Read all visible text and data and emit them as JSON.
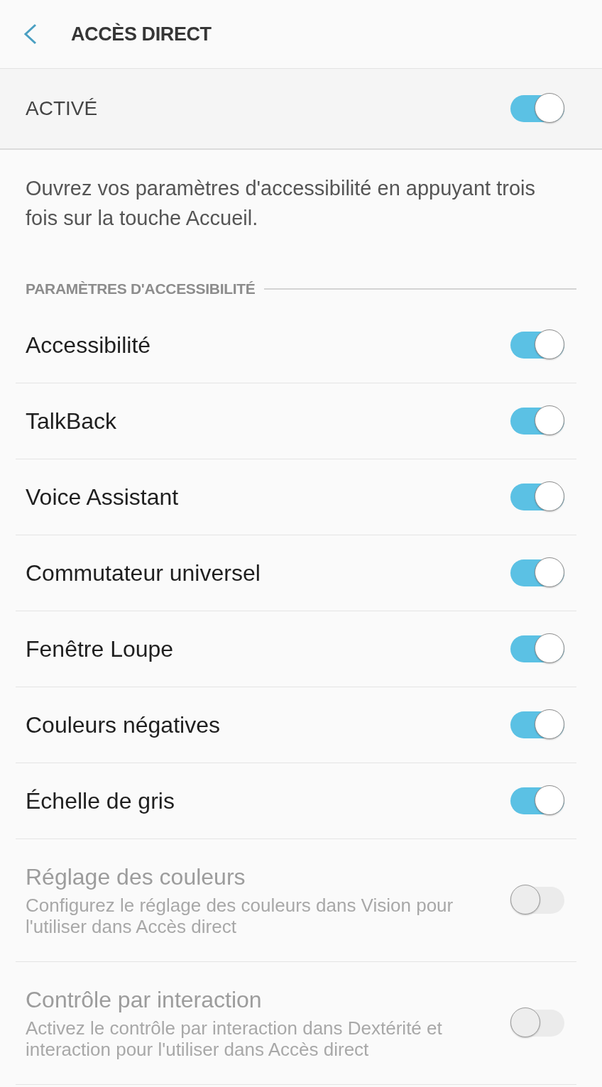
{
  "header": {
    "title": "ACCÈS DIRECT"
  },
  "master_switch": {
    "label": "ACTIVÉ",
    "on": true
  },
  "description": "Ouvrez vos paramètres d'accessibilité en appuyant trois fois sur la touche Accueil.",
  "section": {
    "title": "PARAMÈTRES D'ACCESSIBILITÉ",
    "items": [
      {
        "label": "Accessibilité",
        "on": true,
        "disabled": false
      },
      {
        "label": "TalkBack",
        "on": true,
        "disabled": false
      },
      {
        "label": "Voice Assistant",
        "on": true,
        "disabled": false
      },
      {
        "label": "Commutateur universel",
        "on": true,
        "disabled": false
      },
      {
        "label": "Fenêtre Loupe",
        "on": true,
        "disabled": false
      },
      {
        "label": "Couleurs négatives",
        "on": true,
        "disabled": false
      },
      {
        "label": "Échelle de gris",
        "on": true,
        "disabled": false
      },
      {
        "label": "Réglage des couleurs",
        "subtitle": "Configurez le réglage des couleurs dans Vision pour l'utiliser dans Accès direct",
        "on": false,
        "disabled": true
      },
      {
        "label": "Contrôle par interaction",
        "subtitle": "Activez le contrôle par interaction dans Dextérité et interaction pour l'utiliser dans Accès direct",
        "on": false,
        "disabled": true
      }
    ]
  }
}
